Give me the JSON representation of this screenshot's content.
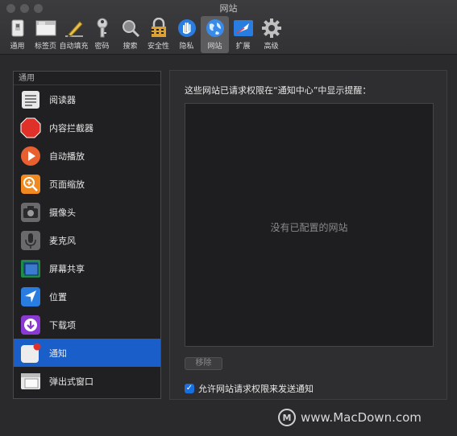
{
  "window": {
    "title": "网站"
  },
  "toolbar": {
    "items": [
      {
        "label": "通用",
        "icon": "general-switch-icon"
      },
      {
        "label": "标签页",
        "icon": "tabs-icon"
      },
      {
        "label": "自动填充",
        "icon": "autofill-pencil-icon"
      },
      {
        "label": "密码",
        "icon": "key-icon"
      },
      {
        "label": "搜索",
        "icon": "magnifier-icon"
      },
      {
        "label": "安全性",
        "icon": "lock-icon"
      },
      {
        "label": "隐私",
        "icon": "hand-icon"
      },
      {
        "label": "网站",
        "icon": "globe-icon",
        "active": true
      },
      {
        "label": "扩展",
        "icon": "extensions-icon"
      },
      {
        "label": "高级",
        "icon": "gear-icon"
      }
    ]
  },
  "sidebar": {
    "header": "通用",
    "items": [
      {
        "label": "阅读器",
        "icon": "reader-icon"
      },
      {
        "label": "内容拦截器",
        "icon": "stop-sign-icon"
      },
      {
        "label": "自动播放",
        "icon": "play-icon"
      },
      {
        "label": "页面缩放",
        "icon": "zoom-icon"
      },
      {
        "label": "摄像头",
        "icon": "camera-icon"
      },
      {
        "label": "麦克风",
        "icon": "microphone-icon"
      },
      {
        "label": "屏幕共享",
        "icon": "screen-share-icon"
      },
      {
        "label": "位置",
        "icon": "location-arrow-icon"
      },
      {
        "label": "下载项",
        "icon": "download-icon"
      },
      {
        "label": "通知",
        "icon": "notification-icon",
        "selected": true
      },
      {
        "label": "弹出式窗口",
        "icon": "popup-window-icon"
      }
    ]
  },
  "panel": {
    "description": "这些网站已请求权限在“通知中心”中显示提醒：",
    "empty_text": "没有已配置的网站",
    "remove_label": "移除",
    "allow_label": "允许网站请求权限来发送通知",
    "allow_checked": true
  },
  "watermark": {
    "text": "www.MacDown.com",
    "logo": "M"
  },
  "colors": {
    "accent": "#1a5fc9",
    "checkbox": "#1a6fe0"
  }
}
